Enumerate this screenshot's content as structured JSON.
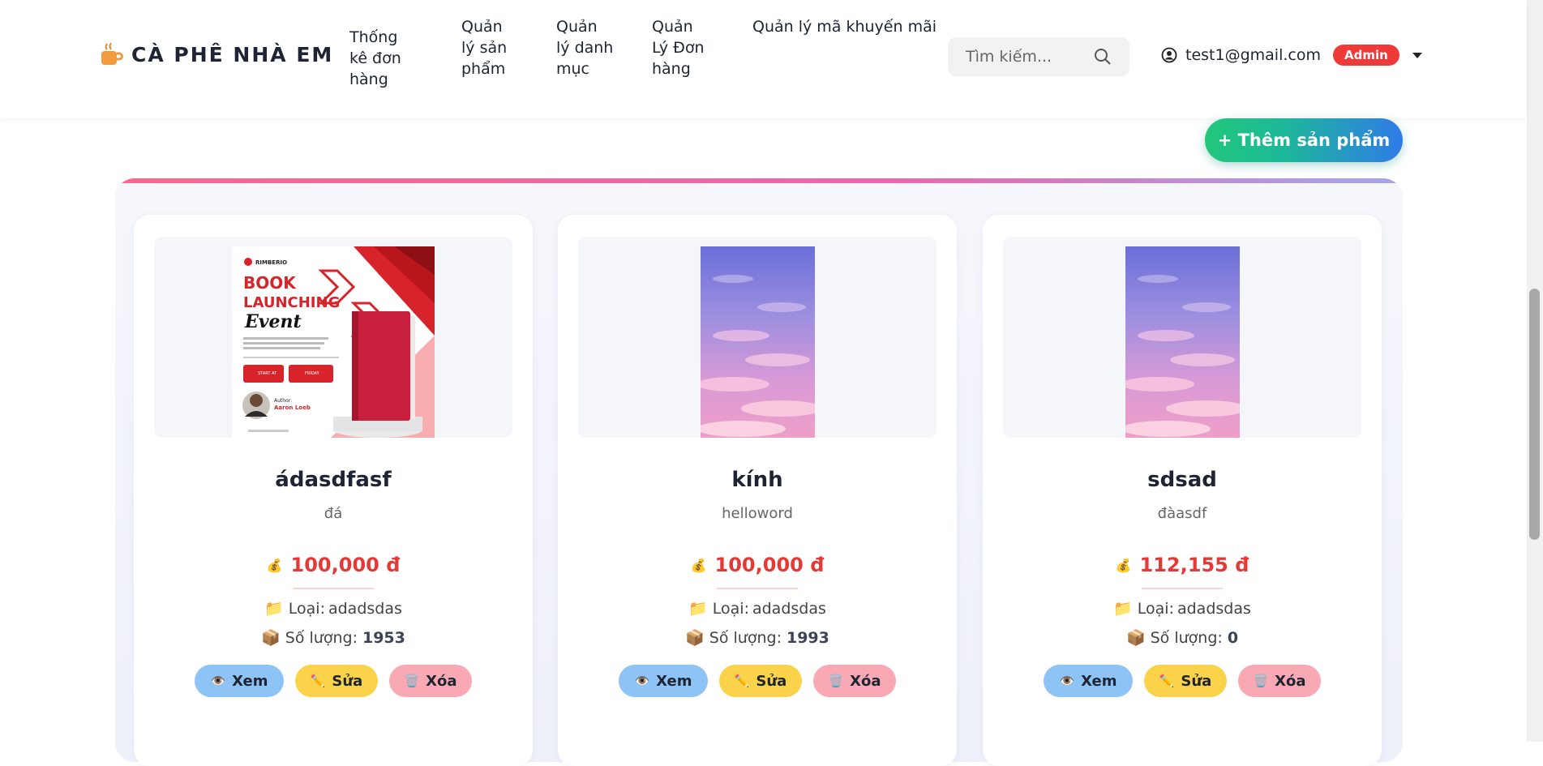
{
  "navbar": {
    "brand": "CÀ PHÊ NHÀ EM",
    "links": [
      {
        "text": "Thống\nkê đơn\nhàng"
      },
      {
        "text": "Quản\nlý sản\nphẩm"
      },
      {
        "text": "Quản\nlý danh\nmục"
      },
      {
        "text": "Quản\nLý Đơn\nhàng"
      },
      {
        "text": "Quản lý mã khuyến mãi"
      }
    ],
    "search_placeholder": "Tìm kiếm...",
    "user_email": "test1@gmail.com",
    "role_badge": "Admin"
  },
  "add_button_label": "+ Thêm sản phẩm",
  "labels": {
    "category_prefix": "Loại: ",
    "quantity_prefix": "Số lượng:",
    "view": "Xem",
    "edit": "Sửa",
    "delete": "Xóa"
  },
  "products": [
    {
      "name": "ádasdfasf",
      "description": "đá",
      "price": "100,000 đ",
      "category": "adadsdas",
      "quantity": "1953",
      "image": "book-launching-poster"
    },
    {
      "name": "kính",
      "description": "helloword",
      "price": "100,000 đ",
      "category": "adadsdas",
      "quantity": "1993",
      "image": "pink-sky"
    },
    {
      "name": "sdsad",
      "description": "đàasdf",
      "price": "112,155 đ",
      "category": "adadsdas",
      "quantity": "0",
      "image": "pink-sky"
    }
  ],
  "poster_text": {
    "brand": "RIMBERIO",
    "line1": "BOOK",
    "line2": "LAUNCHING",
    "line3": "Event",
    "start_label": "START AT",
    "day_label": "FRIDAY",
    "author_label": "Author:",
    "author_name": "Aaron Loeb"
  },
  "colors": {
    "accent_red": "#e53935",
    "badge": "#f03a3a",
    "view_btn": "#8ec3f5",
    "edit_btn": "#fbd34a",
    "delete_btn": "#f9a9b3"
  }
}
